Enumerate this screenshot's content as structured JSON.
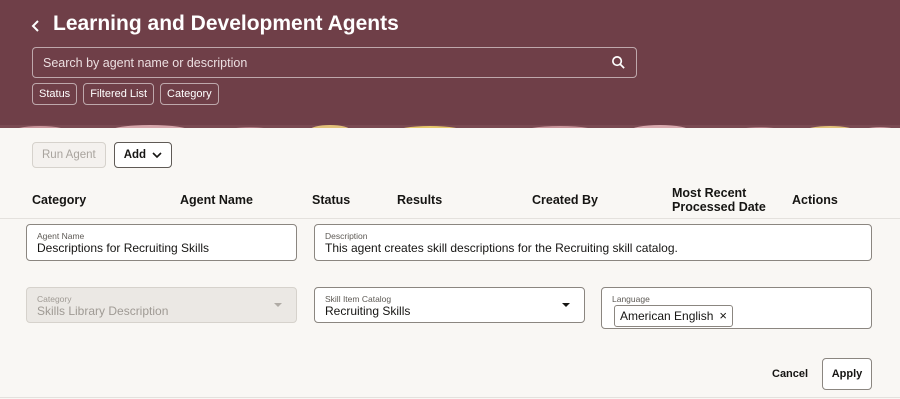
{
  "header": {
    "title": "Learning and Development Agents",
    "search_placeholder": "Search by agent name or description",
    "chips": [
      "Status",
      "Filtered List",
      "Category"
    ]
  },
  "colors": {
    "header_bg": "#6f3f48",
    "page_bg": "#f9f7f4"
  },
  "toolbar": {
    "run_label": "Run Agent",
    "add_label": "Add"
  },
  "table": {
    "columns": [
      "Category",
      "Agent Name",
      "Status",
      "Results",
      "Created By",
      "Most Recent Processed Date",
      "Actions"
    ]
  },
  "form": {
    "agent_name": {
      "label": "Agent Name",
      "value": "Descriptions for Recruiting Skills"
    },
    "description": {
      "label": "Description",
      "value": "This agent creates skill descriptions for the Recruiting skill catalog."
    },
    "category": {
      "label": "Category",
      "value": "Skills Library Description"
    },
    "skill_catalog": {
      "label": "Skill Item Catalog",
      "value": "Recruiting Skills"
    },
    "language": {
      "label": "Language",
      "tag": "American English"
    },
    "cancel_label": "Cancel",
    "apply_label": "Apply"
  },
  "icons": [
    "chevron-left-icon",
    "search-icon",
    "chevron-down-icon",
    "caret-down-icon",
    "close-icon"
  ]
}
